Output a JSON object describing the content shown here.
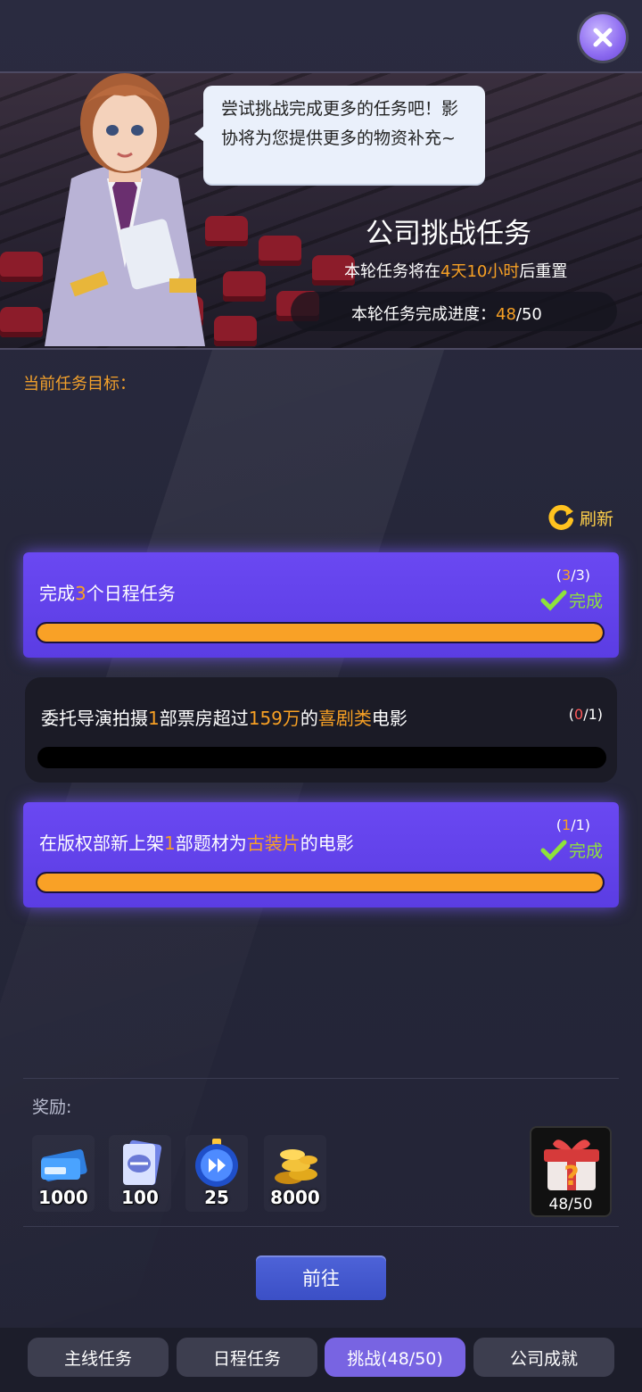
{
  "header": {
    "speech": "尝试挑战完成更多的任务吧！影协将为您提供更多的物资补充~",
    "title": "公司挑战任务",
    "reset": {
      "prefix": "本轮任务将在",
      "time": "4天10小时",
      "suffix": "后重置"
    },
    "progress": {
      "label": "本轮任务完成进度：",
      "current": "48",
      "total": "/50"
    }
  },
  "goal_label": "当前任务目标：",
  "refresh_label": "刷新",
  "tasks": [
    {
      "parts": [
        "完成",
        "3",
        "个日程任务"
      ],
      "count_open": "(",
      "count_cur": "3",
      "count_rest": "/3)",
      "status": "完成",
      "progress": 1.0
    },
    {
      "parts": [
        "委托导演拍摄",
        "1",
        "部票房超过",
        "159万",
        "的",
        "喜剧类",
        "电影"
      ],
      "count_open": "(",
      "count_cur": "0",
      "count_rest": "/1)",
      "status": "",
      "progress": 0.0
    },
    {
      "parts": [
        "在版权部新上架",
        "1",
        "部题材为",
        "古装片",
        "的电影"
      ],
      "count_open": "(",
      "count_cur": "1",
      "count_rest": "/1)",
      "status": "完成",
      "progress": 1.0
    }
  ],
  "rewards": {
    "label": "奖励:",
    "items": [
      {
        "icon": "experience-ticket-icon",
        "amount": "1000"
      },
      {
        "icon": "book-card-icon",
        "amount": "100"
      },
      {
        "icon": "speedup-clock-icon",
        "amount": "25"
      },
      {
        "icon": "gold-coins-icon",
        "amount": "8000"
      }
    ],
    "gift": {
      "icon": "mystery-gift-icon",
      "count": "48/50"
    }
  },
  "go_button": "前往",
  "tabs": [
    {
      "label": "主线任务",
      "active": false
    },
    {
      "label": "日程任务",
      "active": false
    },
    {
      "label": "挑战(48/50)",
      "active": true
    },
    {
      "label": "公司成就",
      "active": false
    }
  ],
  "colors": {
    "accent": "#f7a024",
    "done_panel": "#5b3de3",
    "check": "#8ee23b",
    "tab_active": "#7864e2"
  }
}
